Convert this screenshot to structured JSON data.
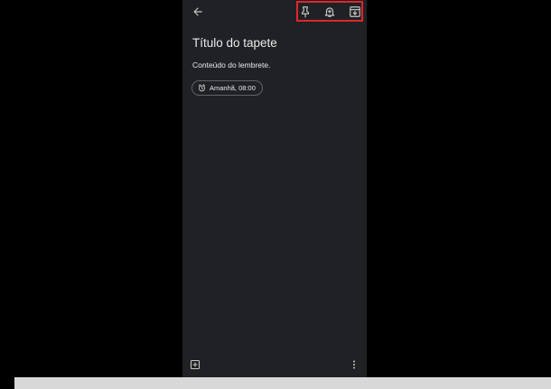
{
  "colors": {
    "screen_background": "#202124",
    "text_primary": "#e8eaed",
    "icon": "#c4c7c5",
    "highlight": "#e2252d",
    "chip_border": "#5f6368"
  },
  "toolbar": {
    "back_icon": "arrow-left-icon",
    "pin_icon": "pin-icon",
    "reminder_icon": "bell-plus-icon",
    "archive_icon": "archive-icon"
  },
  "note": {
    "title": "Título do tapete",
    "body": "Conteúdo do lembrete."
  },
  "reminder": {
    "icon": "alarm-clock-icon",
    "label": "Amanhã, 08:00"
  },
  "bottom_bar": {
    "add_icon": "add-box-icon",
    "more_icon": "more-vert-icon"
  }
}
